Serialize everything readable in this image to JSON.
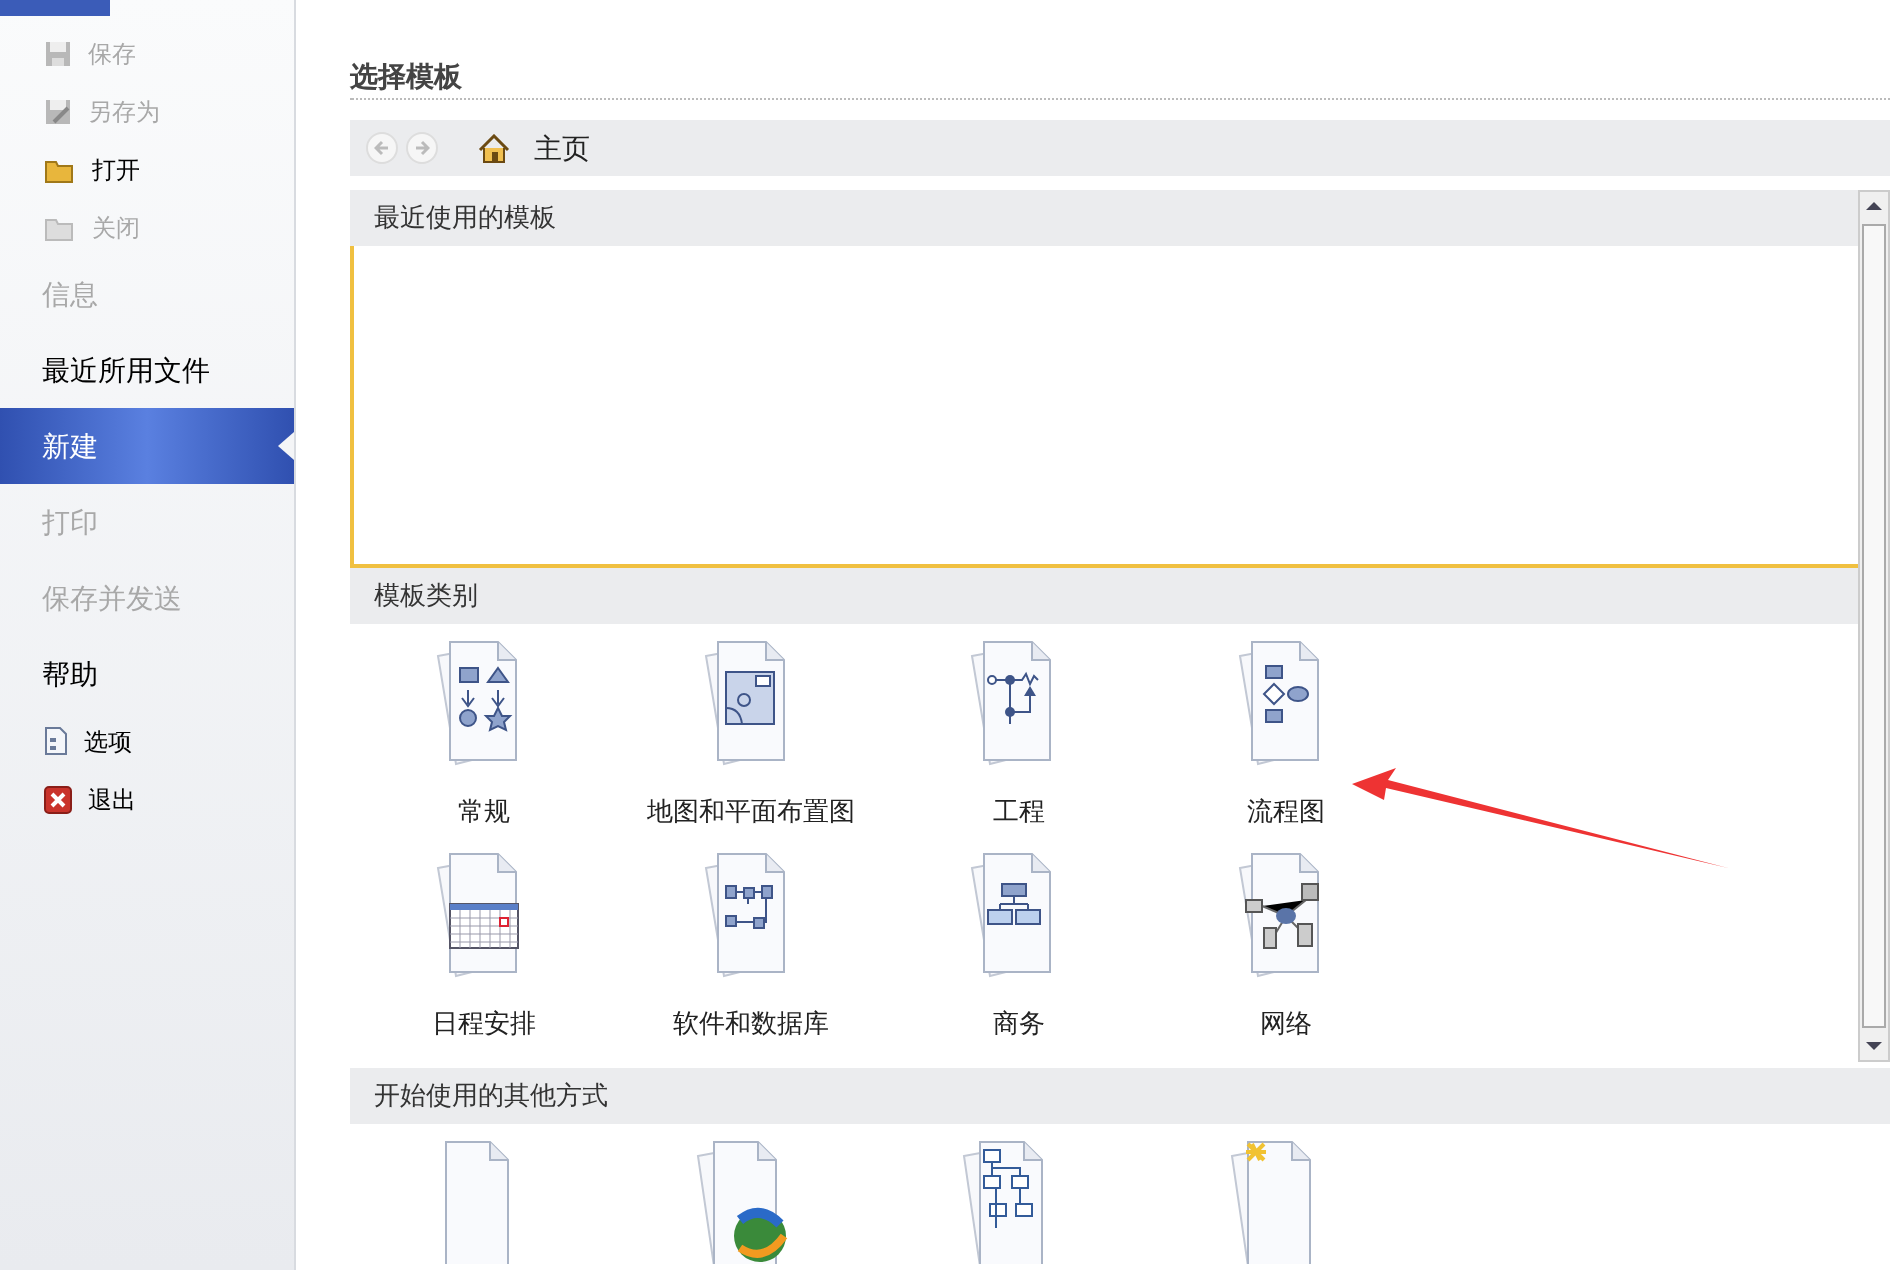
{
  "sidebar": {
    "items": [
      {
        "label": "保存",
        "kind": "command",
        "disabled": true,
        "selected": false
      },
      {
        "label": "另存为",
        "kind": "command",
        "disabled": true,
        "selected": false
      },
      {
        "label": "打开",
        "kind": "command",
        "disabled": false,
        "selected": false
      },
      {
        "label": "关闭",
        "kind": "command",
        "disabled": true,
        "selected": false
      },
      {
        "label": "信息",
        "kind": "tab",
        "disabled": true,
        "selected": false
      },
      {
        "label": "最近所用文件",
        "kind": "tab",
        "disabled": false,
        "selected": false
      },
      {
        "label": "新建",
        "kind": "tab",
        "disabled": false,
        "selected": true
      },
      {
        "label": "打印",
        "kind": "tab",
        "disabled": true,
        "selected": false
      },
      {
        "label": "保存并发送",
        "kind": "tab",
        "disabled": true,
        "selected": false
      },
      {
        "label": "帮助",
        "kind": "tab",
        "disabled": false,
        "selected": false
      },
      {
        "label": "选项",
        "kind": "command",
        "disabled": false,
        "selected": false
      },
      {
        "label": "退出",
        "kind": "command",
        "disabled": false,
        "selected": false
      }
    ]
  },
  "main": {
    "title": "选择模板",
    "nav": {
      "location": "主页"
    },
    "recent": {
      "title": "最近使用的模板"
    },
    "categories": {
      "title": "模板类别",
      "items": [
        {
          "label": "常规"
        },
        {
          "label": "地图和平面布置图"
        },
        {
          "label": "工程"
        },
        {
          "label": "流程图"
        },
        {
          "label": "日程安排"
        },
        {
          "label": "软件和数据库"
        },
        {
          "label": "商务"
        },
        {
          "label": "网络"
        }
      ]
    },
    "other": {
      "title": "开始使用的其他方式"
    }
  }
}
